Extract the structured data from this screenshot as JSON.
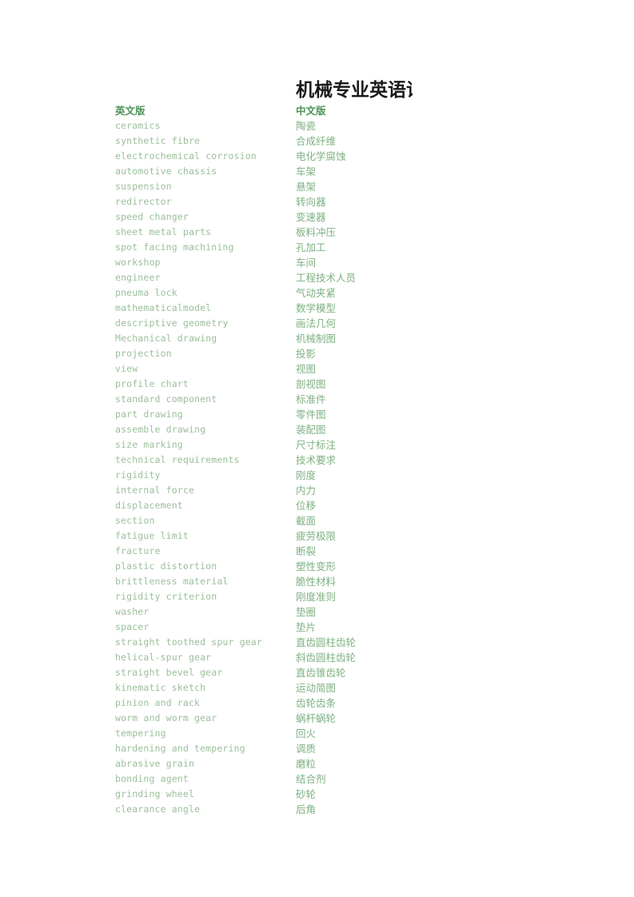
{
  "document": {
    "title": "机械专业英语词",
    "title_note_truncated": true,
    "colors": {
      "title_text": "#1a1a1a",
      "header_text": "#4f9258",
      "english_text": "#9bbf9b",
      "chinese_text": "#7fb183",
      "page_background": "#ffffff"
    }
  },
  "table": {
    "header": {
      "english": "英文版",
      "chinese": "中文版"
    },
    "rows": [
      {
        "english": "ceramics",
        "chinese": "陶瓷"
      },
      {
        "english": "synthetic fibre",
        "chinese": "合成纤维"
      },
      {
        "english": "electrochemical corrosion",
        "chinese": "电化学腐蚀"
      },
      {
        "english": "automotive chassis",
        "chinese": "车架"
      },
      {
        "english": "suspension",
        "chinese": "悬架"
      },
      {
        "english": "redirector",
        "chinese": "转向器"
      },
      {
        "english": "speed changer",
        "chinese": "变速器"
      },
      {
        "english": "sheet metal parts",
        "chinese": "板料冲压"
      },
      {
        "english": "spot facing machining",
        "chinese": "孔加工"
      },
      {
        "english": "workshop",
        "chinese": "车间"
      },
      {
        "english": "engineer",
        "chinese": "工程技术人员"
      },
      {
        "english": "pneuma lock",
        "chinese": "气动夹紧"
      },
      {
        "english": "mathematicalmodel",
        "chinese": "数学模型"
      },
      {
        "english": "descriptive geometry",
        "chinese": "画法几何"
      },
      {
        "english": "Mechanical drawing",
        "chinese": "机械制图"
      },
      {
        "english": "projection",
        "chinese": "投影"
      },
      {
        "english": "view",
        "chinese": "视图"
      },
      {
        "english": "profile chart",
        "chinese": "剖视图"
      },
      {
        "english": "standard component",
        "chinese": "标准件"
      },
      {
        "english": "part drawing",
        "chinese": "零件图"
      },
      {
        "english": "assemble drawing",
        "chinese": "装配图"
      },
      {
        "english": "size marking",
        "chinese": "尺寸标注"
      },
      {
        "english": "technical requirements",
        "chinese": "技术要求"
      },
      {
        "english": "rigidity",
        "chinese": "刚度"
      },
      {
        "english": "internal force",
        "chinese": "内力"
      },
      {
        "english": "displacement",
        "chinese": "位移"
      },
      {
        "english": "section",
        "chinese": "截面"
      },
      {
        "english": "fatigue limit",
        "chinese": "疲劳极限"
      },
      {
        "english": "fracture",
        "chinese": "断裂"
      },
      {
        "english": "plastic distortion",
        "chinese": "塑性变形"
      },
      {
        "english": "brittleness material",
        "chinese": "脆性材料"
      },
      {
        "english": "rigidity criterion",
        "chinese": "刚度准则"
      },
      {
        "english": "washer",
        "chinese": "垫圈"
      },
      {
        "english": "spacer",
        "chinese": "垫片"
      },
      {
        "english": "straight toothed spur gear",
        "chinese": "直齿圆柱齿轮"
      },
      {
        "english": "helical-spur gear",
        "chinese": "斜齿圆柱齿轮"
      },
      {
        "english": "straight bevel gear",
        "chinese": "直齿锥齿轮"
      },
      {
        "english": "kinematic sketch",
        "chinese": "运动简图"
      },
      {
        "english": "pinion and rack",
        "chinese": "齿轮齿条"
      },
      {
        "english": "worm and worm gear",
        "chinese": "蜗杆蜗轮"
      },
      {
        "english": "tempering",
        "chinese": "回火"
      },
      {
        "english": "hardening and tempering",
        "chinese": "调质"
      },
      {
        "english": "abrasive grain",
        "chinese": "磨粒"
      },
      {
        "english": "bonding agent",
        "chinese": "结合剂"
      },
      {
        "english": "grinding wheel",
        "chinese": "砂轮"
      },
      {
        "english": "clearance angle",
        "chinese": "后角"
      }
    ]
  }
}
